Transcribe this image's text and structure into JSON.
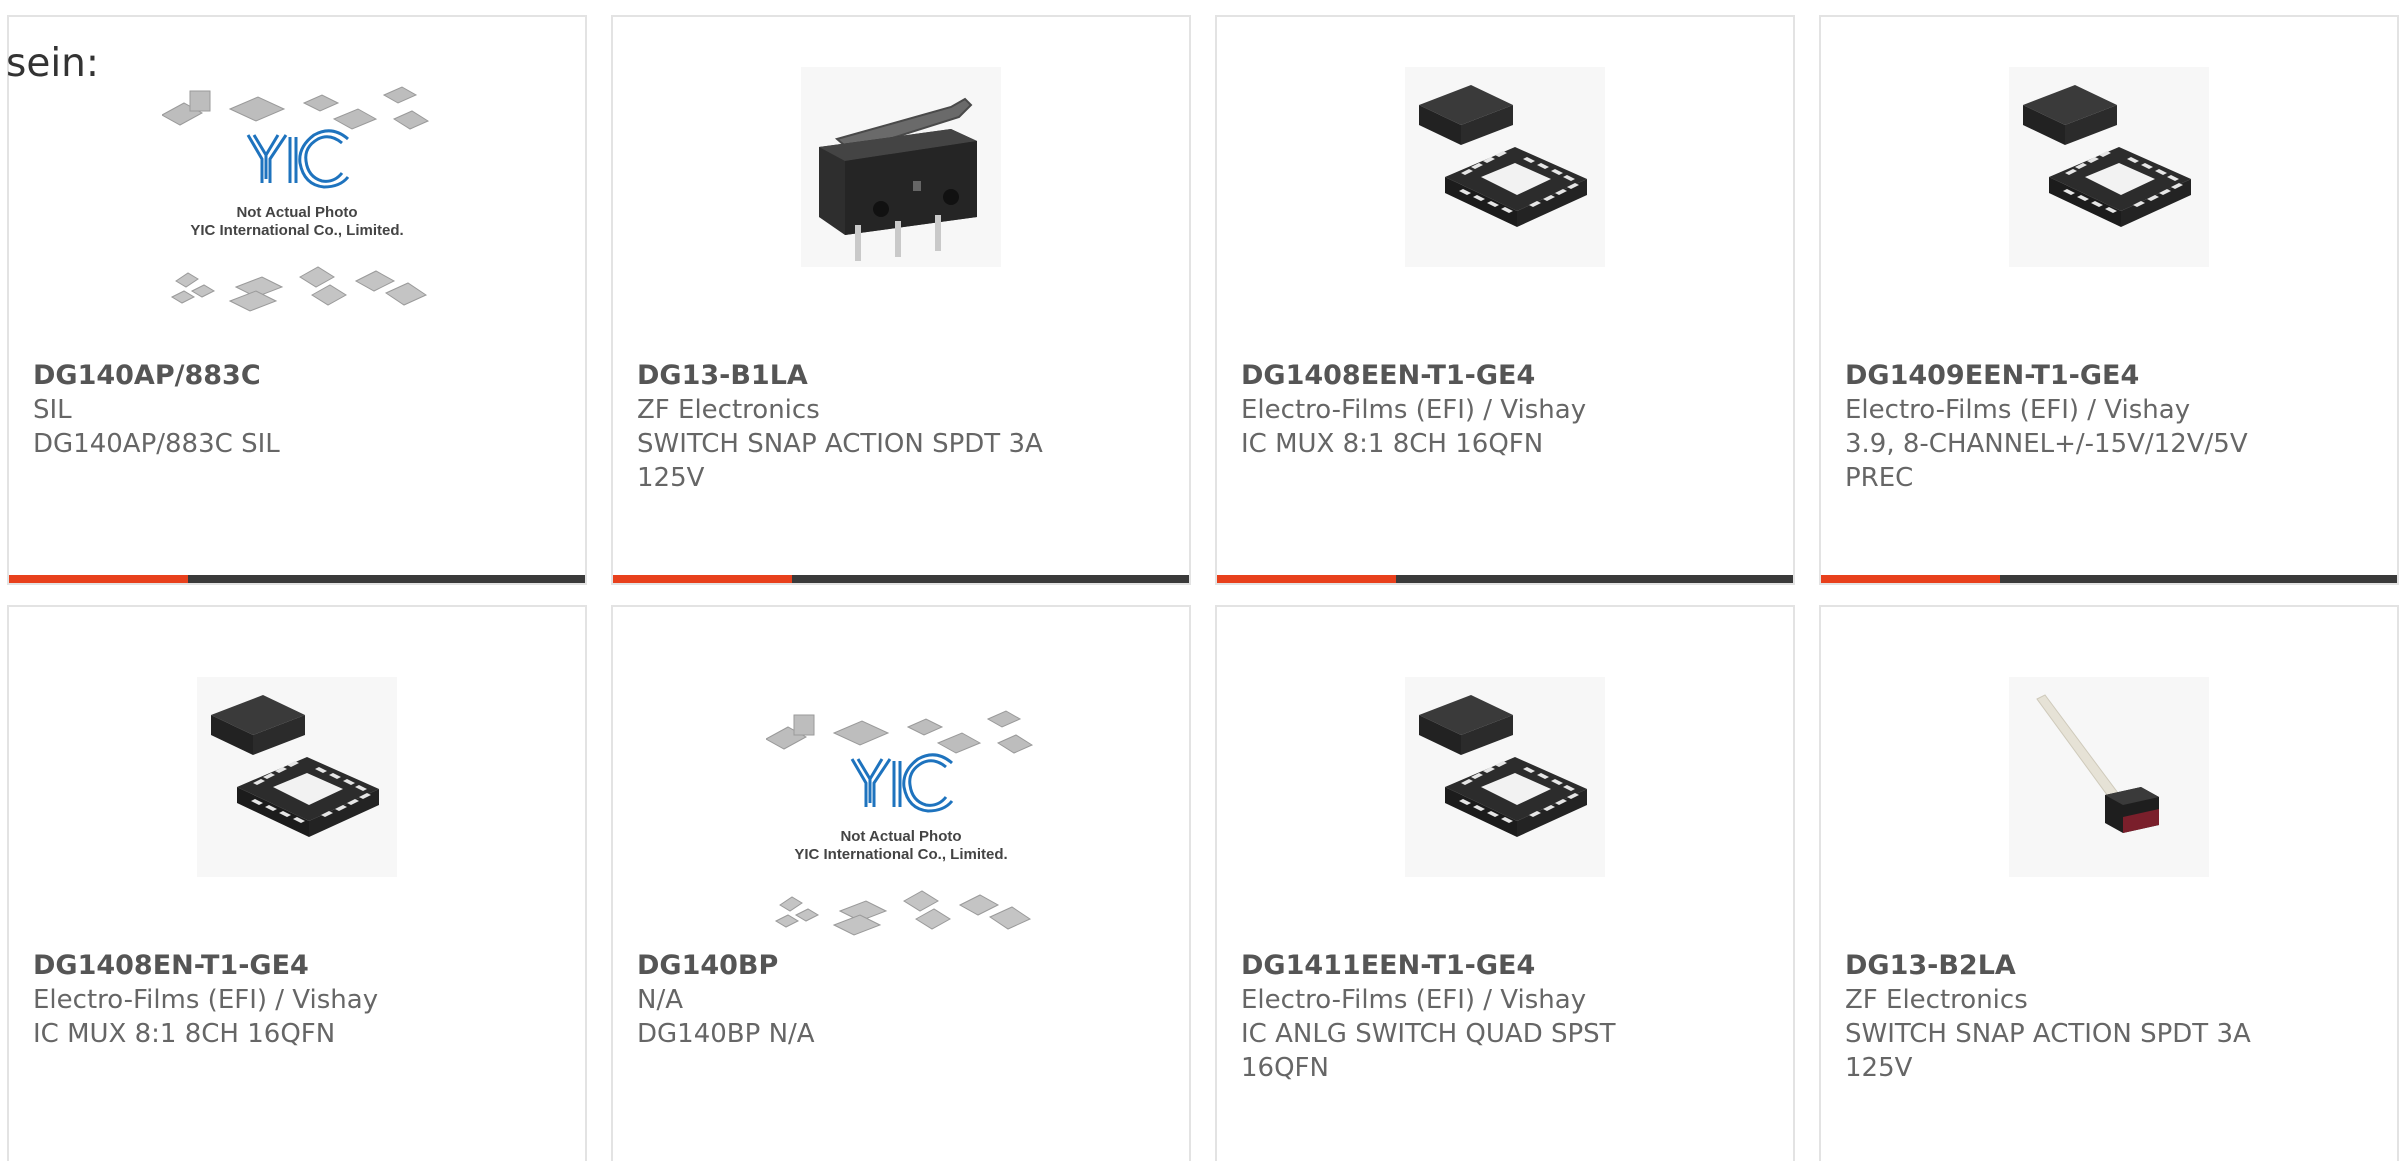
{
  "intro": {
    "text": "sein:"
  },
  "accent": {
    "highlight": "#e8401c",
    "track": "#3a3a3a",
    "border": "#e3e3e3"
  },
  "products": [
    {
      "part_number": "DG140AP/883C",
      "manufacturer": "SIL",
      "description": "DG140AP/883C SIL",
      "image": "placeholder-logo",
      "placeholder": {
        "line1": "Not Actual Photo",
        "line2": "YIC International Co., Limited.",
        "logo": "YIC"
      },
      "hover_progress": 0.31
    },
    {
      "part_number": "DG13-B1LA",
      "manufacturer": "ZF Electronics",
      "description": "SWITCH SNAP ACTION SPDT 3A 125V",
      "image": "snap-switch-lever",
      "hover_progress": 0.31
    },
    {
      "part_number": "DG1408EEN-T1-GE4",
      "manufacturer": "Electro-Films (EFI) / Vishay",
      "description": "IC MUX 8:1 8CH 16QFN",
      "image": "qfn-chip",
      "hover_progress": 0.31
    },
    {
      "part_number": "DG1409EEN-T1-GE4",
      "manufacturer": "Electro-Films (EFI) / Vishay",
      "description": "3.9, 8-CHANNEL+/-15V/12V/5V PREC",
      "image": "qfn-chip",
      "hover_progress": 0.31
    },
    {
      "part_number": "DG1408EN-T1-GE4",
      "manufacturer": "Electro-Films (EFI) / Vishay",
      "description": "IC MUX 8:1 8CH 16QFN",
      "image": "qfn-chip"
    },
    {
      "part_number": "DG140BP",
      "manufacturer": "N/A",
      "description": "DG140BP N/A",
      "image": "placeholder-logo",
      "placeholder": {
        "line1": "Not Actual Photo",
        "line2": "YIC International Co., Limited.",
        "logo": "YIC"
      }
    },
    {
      "part_number": "DG1411EEN-T1-GE4",
      "manufacturer": "Electro-Films (EFI) / Vishay",
      "description": "IC ANLG SWITCH QUAD SPST 16QFN",
      "image": "qfn-chip"
    },
    {
      "part_number": "DG13-B2LA",
      "manufacturer": "ZF Electronics",
      "description": "SWITCH SNAP ACTION SPDT 3A 125V",
      "image": "micro-switch-long-lever"
    }
  ]
}
